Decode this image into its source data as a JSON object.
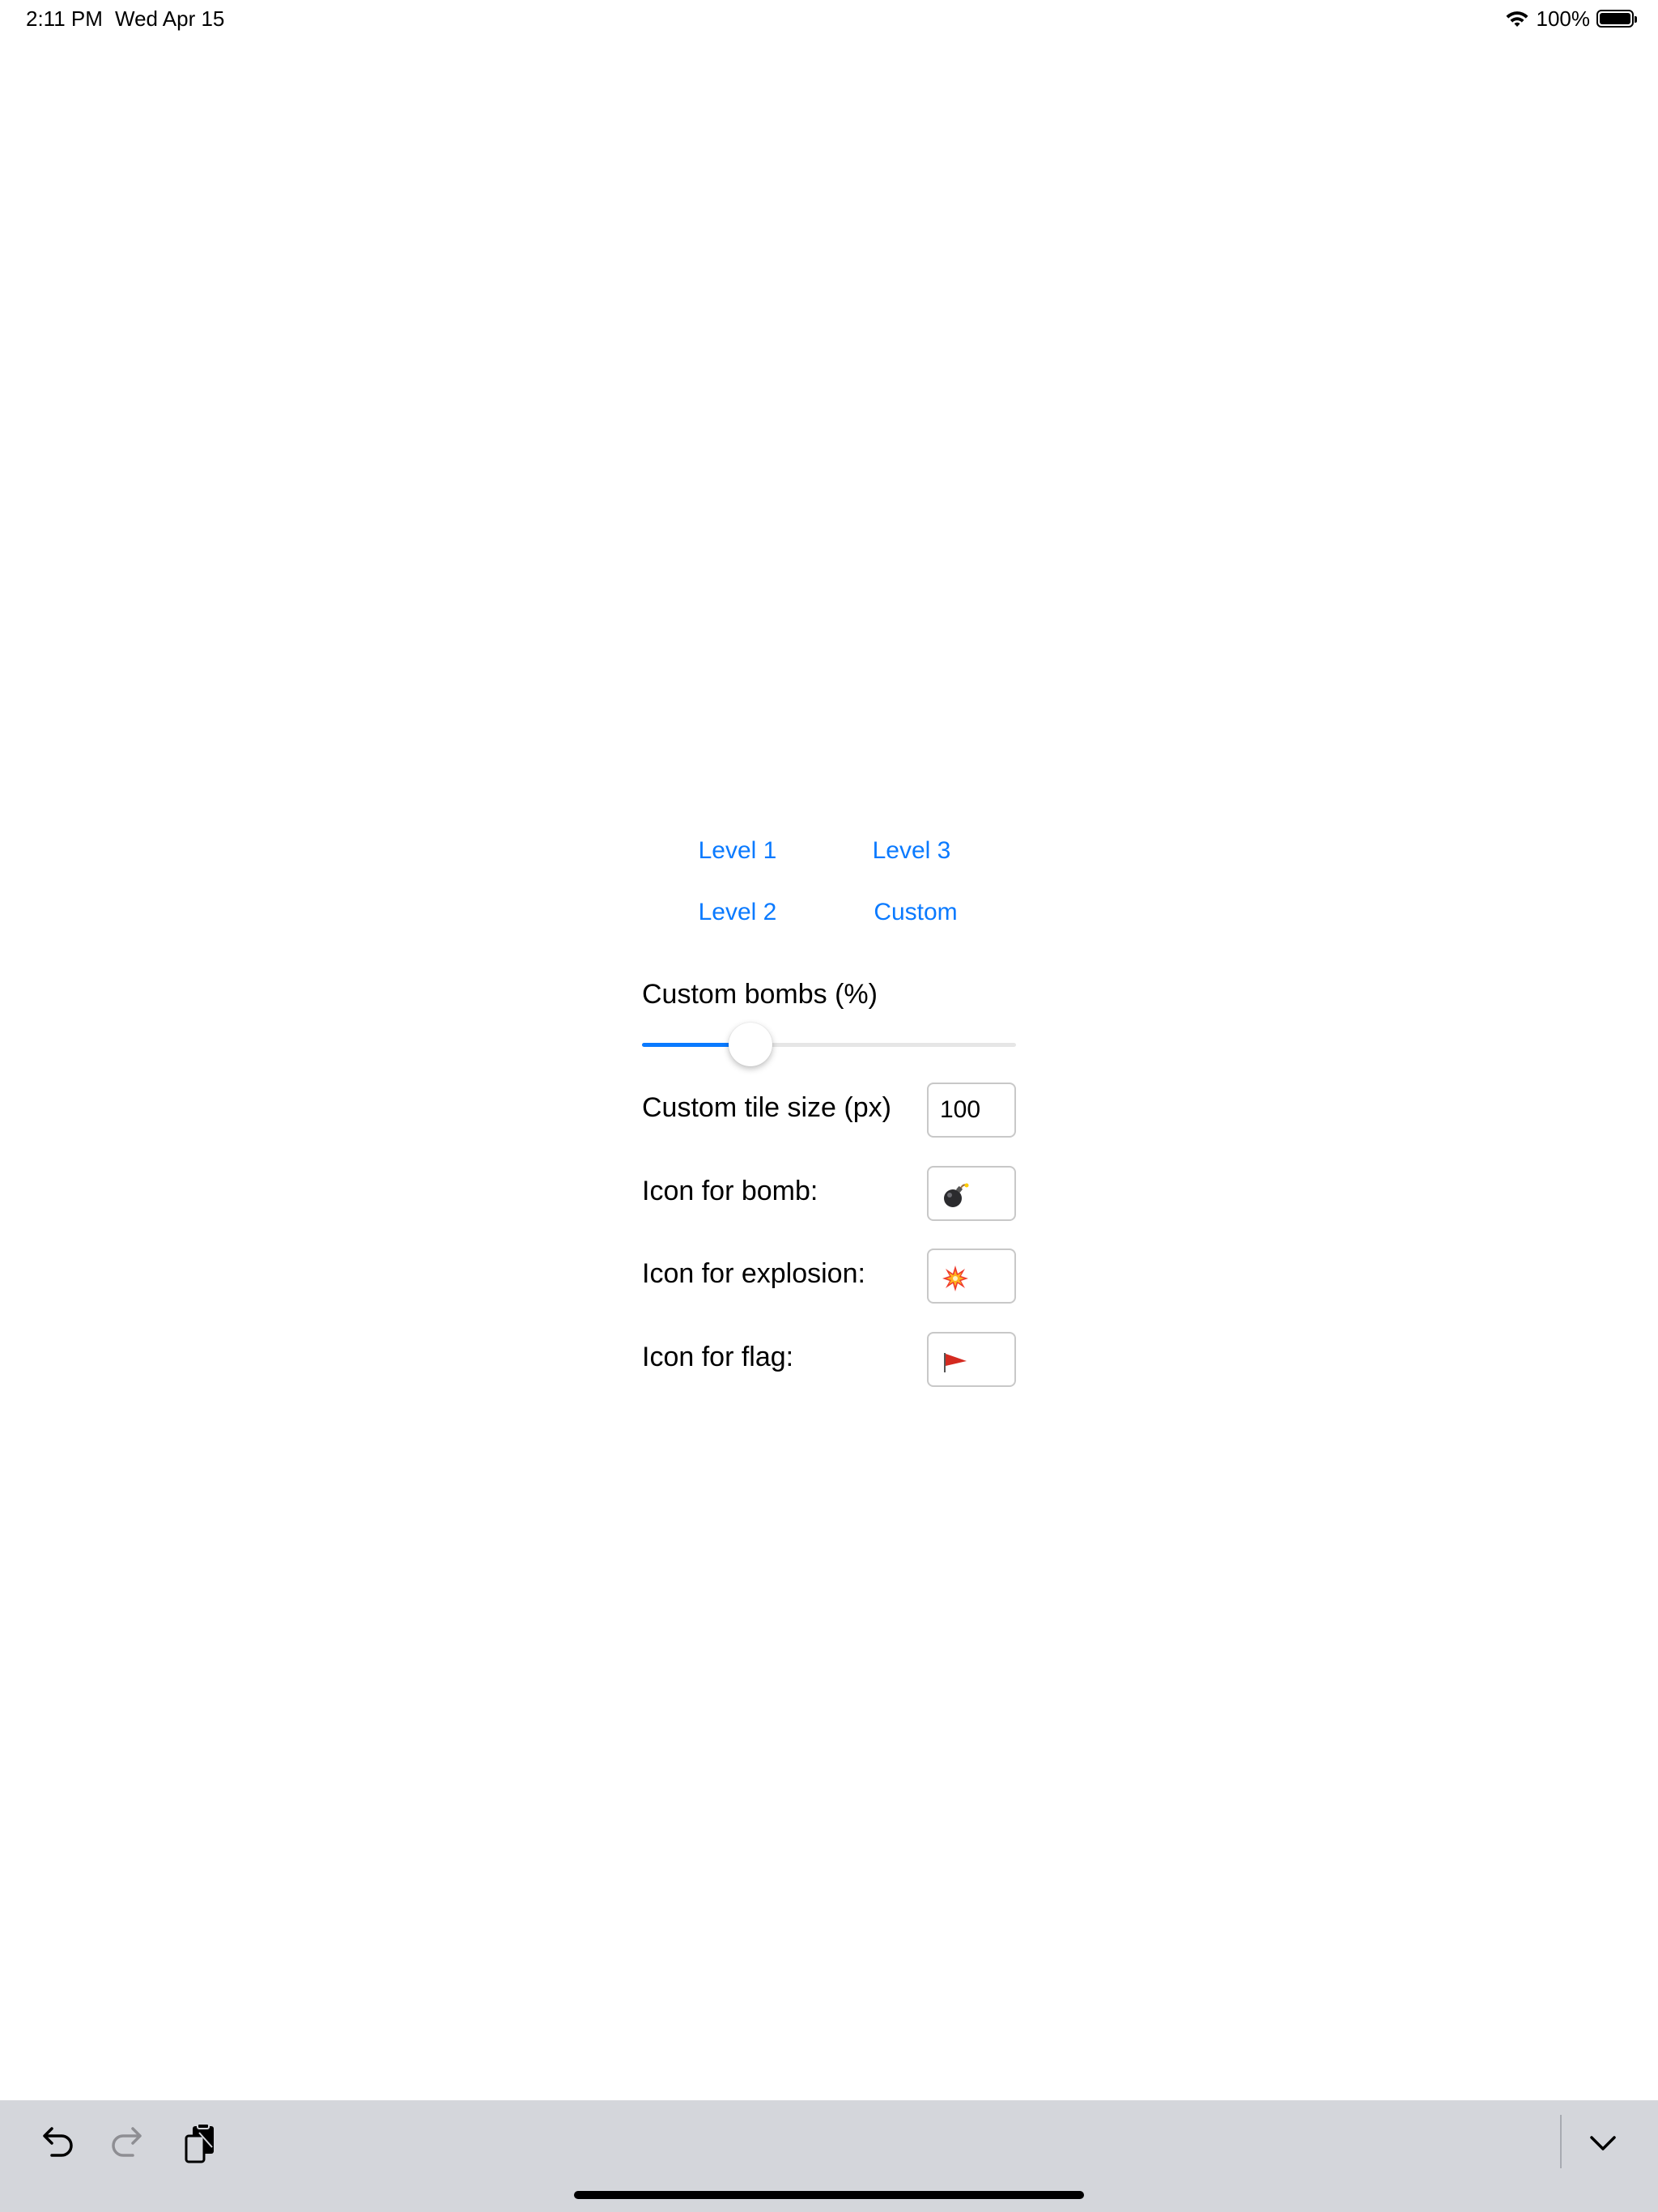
{
  "status_bar": {
    "time": "2:11 PM",
    "date": "Wed Apr 15",
    "battery_percent": "100%",
    "icons": [
      "wifi-icon",
      "battery-icon"
    ]
  },
  "levels": {
    "level1": "Level 1",
    "level2": "Level 2",
    "level3": "Level 3",
    "custom": "Custom"
  },
  "settings": {
    "bombs_label": "Custom bombs (%)",
    "bombs_slider_fraction": 0.29,
    "tile_size_label": "Custom tile size (px)",
    "tile_size_value": "100",
    "bomb_icon_label": "Icon for bomb:",
    "bomb_icon": "bomb-icon",
    "explosion_icon_label": "Icon for explosion:",
    "explosion_icon": "explosion-icon",
    "flag_icon_label": "Icon for flag:",
    "flag_icon": "flag-icon"
  },
  "toolbar": {
    "icons": [
      "undo-icon",
      "redo-icon",
      "paste-icon",
      "chevron-down-icon"
    ]
  },
  "colors": {
    "accent": "#0a7aff",
    "toolbar_bg": "#d4d6db"
  }
}
